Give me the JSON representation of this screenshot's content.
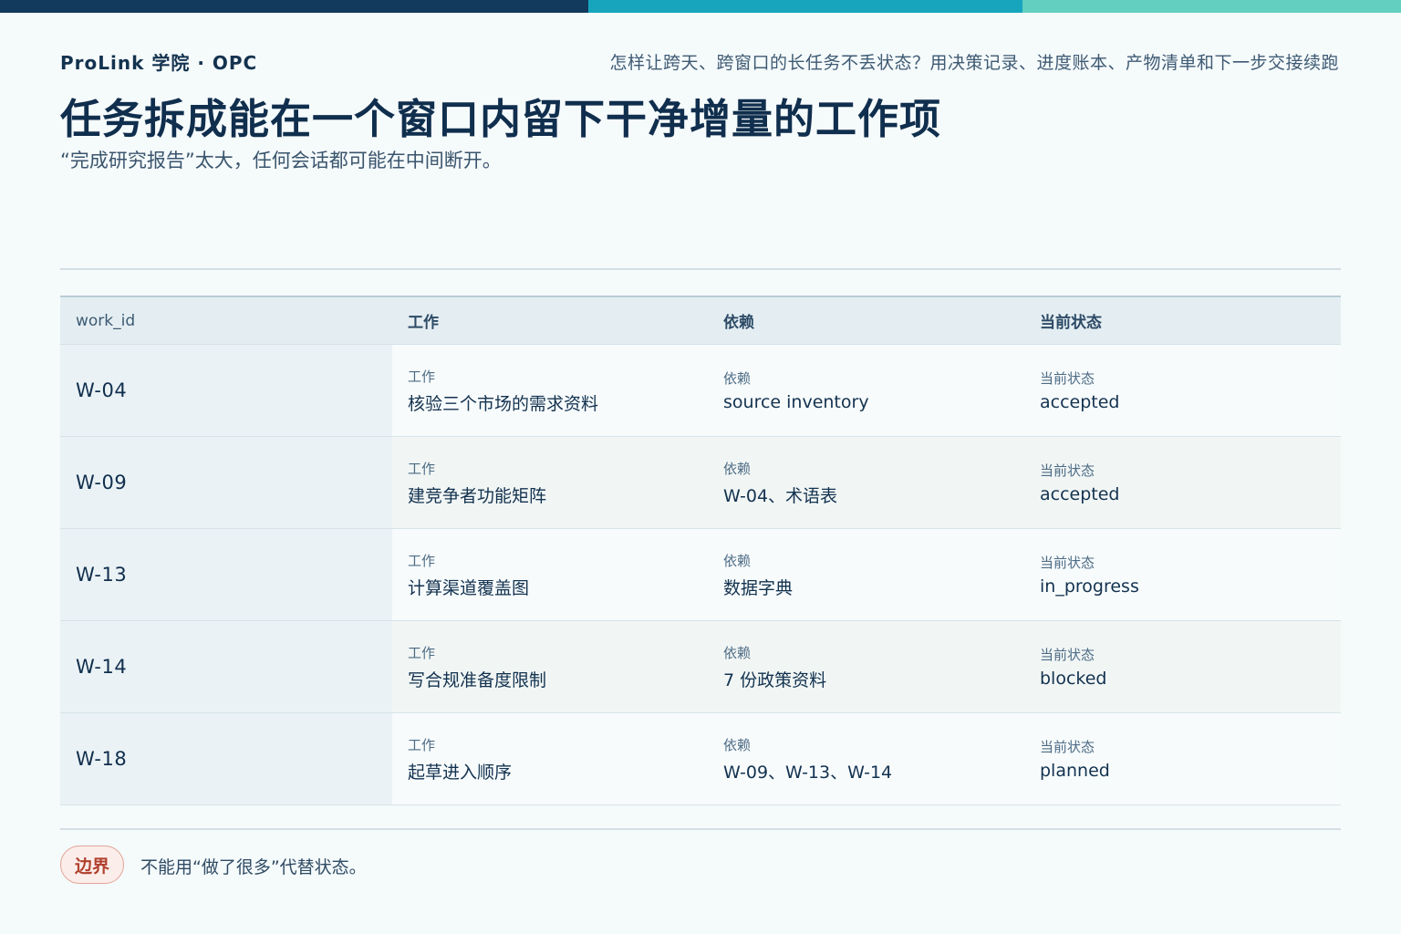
{
  "header": {
    "brand": "ProLink 学院 · OPC",
    "tagline": "怎样让跨天、跨窗口的长任务不丢状态？用决策记录、进度账本、产物清单和下一步交接续跑",
    "title": "任务拆成能在一个窗口内留下干净增量的工作项",
    "subtitle": "“完成研究报告”太大，任何会话都可能在中间断开。"
  },
  "colors": {
    "bar_navy": "#113a5c",
    "bar_teal": "#17a5bd",
    "bar_mint": "#63cfc0",
    "badge_red": "#b2412f"
  },
  "table": {
    "headers": [
      "work_id",
      "工作",
      "依赖",
      "当前状态"
    ],
    "rows": [
      {
        "id": "W-04",
        "work": "核验三个市场的需求资料",
        "deps": "source inventory",
        "status": "accepted"
      },
      {
        "id": "W-09",
        "work": "建竞争者功能矩阵",
        "deps": "W-04、术语表",
        "status": "accepted"
      },
      {
        "id": "W-13",
        "work": "计算渠道覆盖图",
        "deps": "数据字典",
        "status": "in_progress"
      },
      {
        "id": "W-14",
        "work": "写合规准备度限制",
        "deps": "7 份政策资料",
        "status": "blocked"
      },
      {
        "id": "W-18",
        "work": "起草进入顺序",
        "deps": "W-09、W-13、W-14",
        "status": "planned"
      }
    ]
  },
  "footer": {
    "badge": "边界",
    "note": "不能用“做了很多”代替状态。"
  }
}
